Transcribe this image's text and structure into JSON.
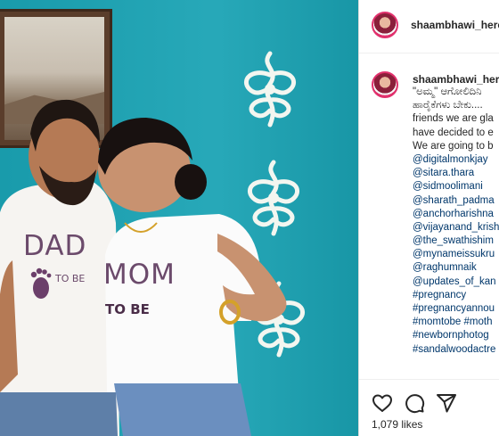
{
  "post": {
    "username": "shaambhawi_here",
    "likes": "1,079 likes"
  },
  "caption": {
    "username": "shaambhawi_here",
    "lines": [
      {
        "text": "\"ಅಮ್ಮ\" ಆಗೋಲಿದಿನಿ",
        "link": false
      },
      {
        "text": "ಹಾರೈಕೆಗಳು ಬೇಕು....",
        "link": false
      },
      {
        "text": "friends we are gla",
        "link": false
      },
      {
        "text": "have decided to e",
        "link": false
      },
      {
        "text": "We are going to b",
        "link": false
      },
      {
        "text": "@digitalmonkjay",
        "link": true
      },
      {
        "text": "@sitara.thara",
        "link": true
      },
      {
        "text": "@sidmoolimani",
        "link": true
      },
      {
        "text": "@sharath_padma",
        "link": true
      },
      {
        "text": "@anchorharishna",
        "link": true
      },
      {
        "text": "@vijayanand_krish",
        "link": true
      },
      {
        "text": "@the_swathishim",
        "link": true
      },
      {
        "text": "@mynameissukru",
        "link": true
      },
      {
        "text": "@raghumnaik",
        "link": true
      },
      {
        "text": "@updates_of_kan",
        "link": true
      },
      {
        "text": "#pregnancy",
        "link": true
      },
      {
        "text": "#pregnancyannou",
        "link": true
      },
      {
        "text": "#momtobe #moth",
        "link": true
      },
      {
        "text": "#newbornphotog",
        "link": true
      },
      {
        "text": "#sandalwoodactre",
        "link": true
      }
    ]
  },
  "shirts": {
    "dad": "DAD",
    "dad_sub": "TO BE",
    "mom": "MOM",
    "mom_sub": "TO BE"
  },
  "icons": [
    "heart-icon",
    "comment-icon",
    "share-icon"
  ],
  "colors": {
    "wall": "#1aa3b4",
    "link": "#00376b",
    "text": "#262626",
    "border": "#dbdbdb"
  }
}
